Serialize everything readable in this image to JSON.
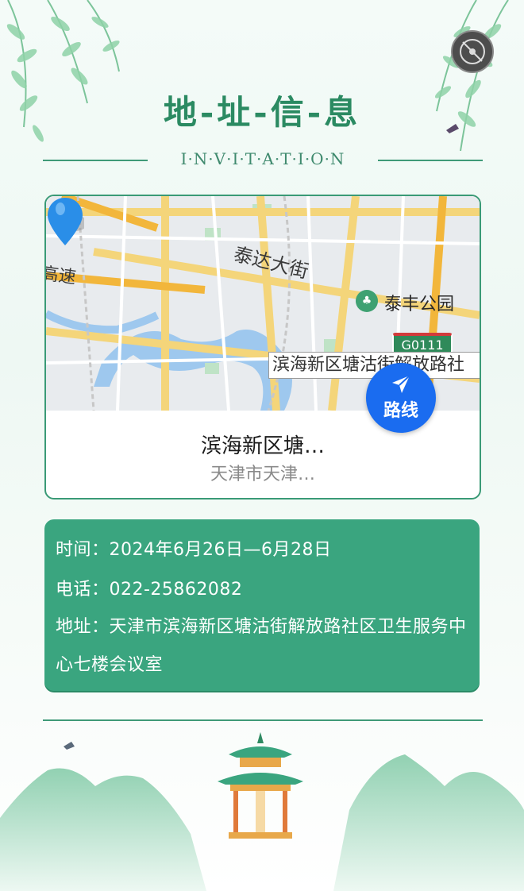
{
  "header": {
    "title": "地-址-信-息",
    "subtitle": "I·N·V·I·T·A·T·I·O·N"
  },
  "music_button": {
    "icon": "music-disc-icon"
  },
  "map": {
    "road_label_1": "泰达大街",
    "road_label_2": "高速",
    "park_label": "泰丰公园",
    "highway_badge": "G0111",
    "callout": "滨海新区塘沽街解放路社",
    "route_button_label": "路线",
    "place_name": "滨海新区塘…",
    "place_address": "天津市天津…"
  },
  "info": {
    "time_line": "时间：2024年6月26日—6月28日",
    "phone_line": "电话：022-25862082",
    "address_line": "地址：天津市滨海新区塘沽街解放路社区卫生服务中心七楼会议室"
  },
  "colors": {
    "accent": "#3aa57f",
    "title": "#2b8a62",
    "route_button": "#1a6cf0"
  }
}
